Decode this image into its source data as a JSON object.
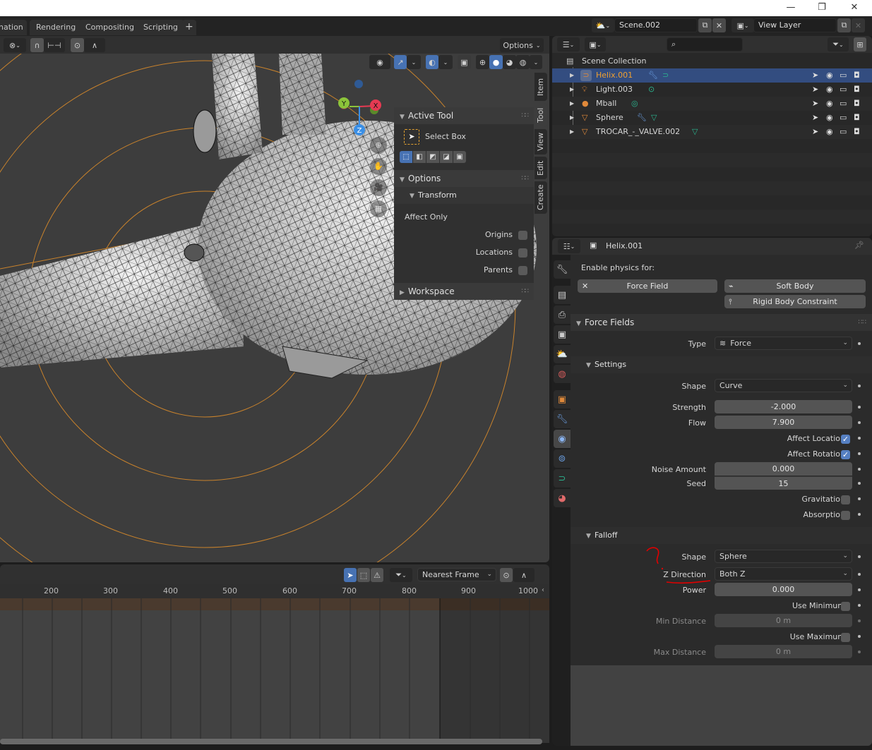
{
  "window": {
    "minimize_icon": "—",
    "maximize_icon": "❐",
    "close_icon": "✕"
  },
  "workspace_tabs": [
    "nation",
    "Rendering",
    "Compositing",
    "Scripting"
  ],
  "add_workspace_label": "+",
  "scene": {
    "name": "Scene.002",
    "view_layer": "View Layer"
  },
  "viewport": {
    "options_label": "Options",
    "gizmo_axes": {
      "x": "X",
      "y": "Y",
      "z": "Z"
    },
    "n_panel_tabs": [
      "Item",
      "Tool",
      "View",
      "Edit",
      "Create"
    ],
    "active_n_tab": "Tool",
    "active_tool": {
      "header": "Active Tool",
      "tool_name": "Select Box"
    },
    "options": {
      "header": "Options",
      "transform_header": "Transform",
      "affect_only_label": "Affect Only",
      "checkboxes": [
        {
          "label": "Origins",
          "checked": false
        },
        {
          "label": "Locations",
          "checked": false
        },
        {
          "label": "Parents",
          "checked": false
        }
      ]
    },
    "workspace_header": "Workspace"
  },
  "timeline": {
    "snap_mode": "Nearest Frame",
    "ruler_ticks": [
      "200",
      "300",
      "400",
      "500",
      "600",
      "700",
      "800",
      "900",
      "1000"
    ]
  },
  "outliner": {
    "search_placeholder": "",
    "root": "Scene Collection",
    "items": [
      {
        "name": "Helix.001",
        "type": "curve",
        "selected": true,
        "extras": [
          "modifier",
          "curve-data"
        ]
      },
      {
        "name": "Light.003",
        "type": "light",
        "selected": false,
        "extras": [
          "light-data"
        ]
      },
      {
        "name": "Mball",
        "type": "metaball",
        "selected": false,
        "extras": [
          "metaball-data"
        ]
      },
      {
        "name": "Sphere",
        "type": "mesh",
        "selected": false,
        "extras": [
          "modifier",
          "mesh-data"
        ]
      },
      {
        "name": "TROCAR_-_VALVE.002",
        "type": "mesh",
        "selected": false,
        "extras": [
          "mesh-data"
        ]
      }
    ]
  },
  "properties": {
    "object_name": "Helix.001",
    "enable_physics_label": "Enable physics for:",
    "physics_buttons": {
      "force_field": "Force Field",
      "soft_body": "Soft Body",
      "rigid_body_constraint": "Rigid Body Constraint"
    },
    "force_fields_header": "Force Fields",
    "type_label": "Type",
    "type_value": "Force",
    "settings_header": "Settings",
    "settings": {
      "shape_label": "Shape",
      "shape_value": "Curve",
      "strength_label": "Strength",
      "strength_value": "-2.000",
      "flow_label": "Flow",
      "flow_value": "7.900",
      "affect_location_label": "Affect Location",
      "affect_location": true,
      "affect_rotation_label": "Affect Rotation",
      "affect_rotation": true,
      "noise_label": "Noise Amount",
      "noise_value": "0.000",
      "seed_label": "Seed",
      "seed_value": "15",
      "gravitation_label": "Gravitation",
      "gravitation": false,
      "absorption_label": "Absorption",
      "absorption": false
    },
    "falloff_header": "Falloff",
    "falloff": {
      "shape_label": "Shape",
      "shape_value": "Sphere",
      "zdir_label": "Z Direction",
      "zdir_value": "Both Z",
      "power_label": "Power",
      "power_value": "0.000",
      "use_min_label": "Use Minimum",
      "use_min": false,
      "min_dist_label": "Min Distance",
      "min_dist_value": "0 m",
      "use_max_label": "Use Maximum",
      "use_max": false,
      "max_dist_label": "Max Distance",
      "max_dist_value": "0 m"
    },
    "annotation": {
      "color": "#e00000",
      "mark": "?"
    }
  },
  "colors": {
    "accent_blue": "#5680c2",
    "selection_row": "#334d80",
    "selected_object_text": "#f0a030",
    "object_icon_orange": "#e0893a",
    "data_icon_green": "#2bb58f",
    "modifier_blue": "#6a9de0",
    "force_field_ring": "#c8822c"
  }
}
